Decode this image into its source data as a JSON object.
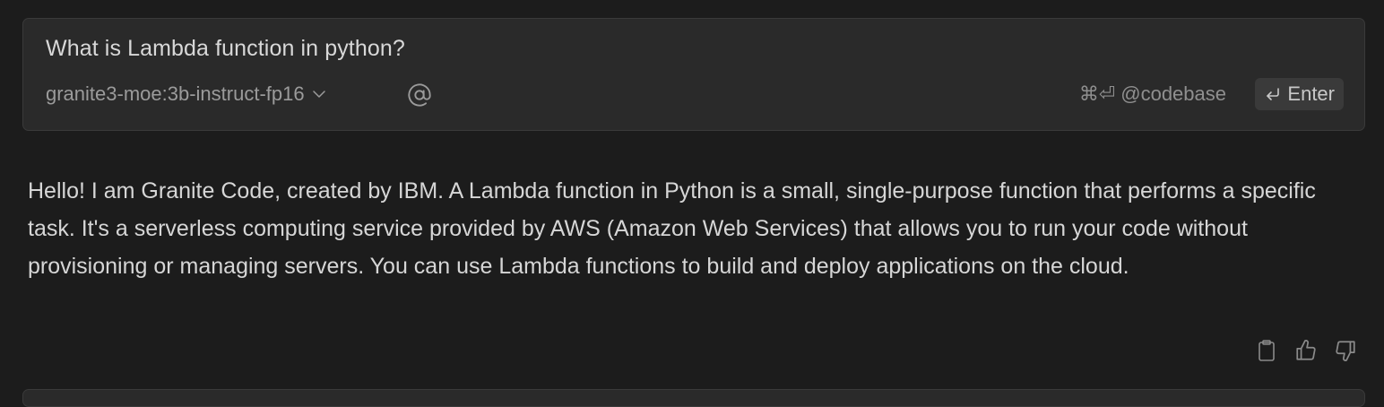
{
  "input": {
    "question": "What is Lambda function in python?",
    "model": "granite3-moe:3b-instruct-fp16",
    "codebase_shortcut": "⌘⏎",
    "codebase_label": "@codebase",
    "enter_label": "Enter"
  },
  "response": {
    "text": "Hello! I am Granite Code, created by IBM. A Lambda function in Python is a small, single-purpose function that performs a specific task. It's a serverless computing service provided by AWS (Amazon Web Services) that allows you to run your code without provisioning or managing servers. You can use Lambda functions to build and deploy applications on the cloud."
  },
  "icons": {
    "model_chevron": "chevron-down-icon",
    "mention": "at-icon",
    "enter": "return-icon",
    "copy": "clipboard-icon",
    "thumbs_up": "thumbs-up-icon",
    "thumbs_down": "thumbs-down-icon"
  },
  "colors": {
    "background": "#1c1c1c",
    "card": "#2a2a2a",
    "card_border": "#3a3a3a",
    "text": "#d6d6d6",
    "muted": "#9b9b9b"
  }
}
